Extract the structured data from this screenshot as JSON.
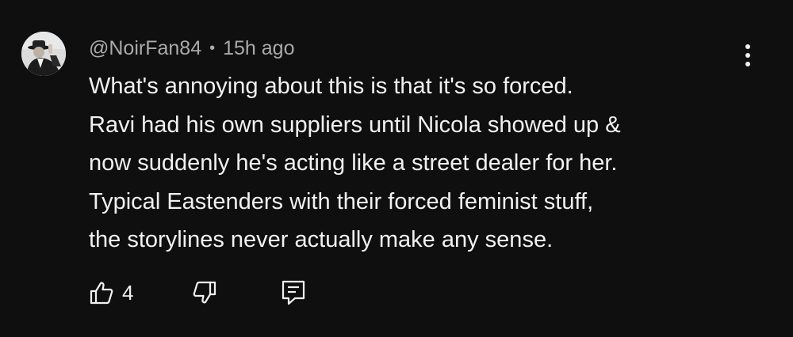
{
  "comment": {
    "author": "@NoirFan84",
    "separator": "•",
    "timestamp": "15h ago",
    "text_lines": [
      "What's annoying about this is that it's so forced.",
      "Ravi had his own suppliers until Nicola showed up &",
      "now suddenly he's acting like a street dealer for her.",
      "Typical Eastenders with their forced feminist stuff,",
      "the storylines never actually make any sense."
    ],
    "like_count": "4"
  },
  "icons": {
    "more": "more-vertical-icon",
    "like": "thumbs-up-icon",
    "dislike": "thumbs-down-icon",
    "reply": "reply-comment-icon"
  },
  "colors": {
    "background": "#0f0f0f",
    "text_primary": "#f1f1f1",
    "text_secondary": "#aaaaaa"
  }
}
